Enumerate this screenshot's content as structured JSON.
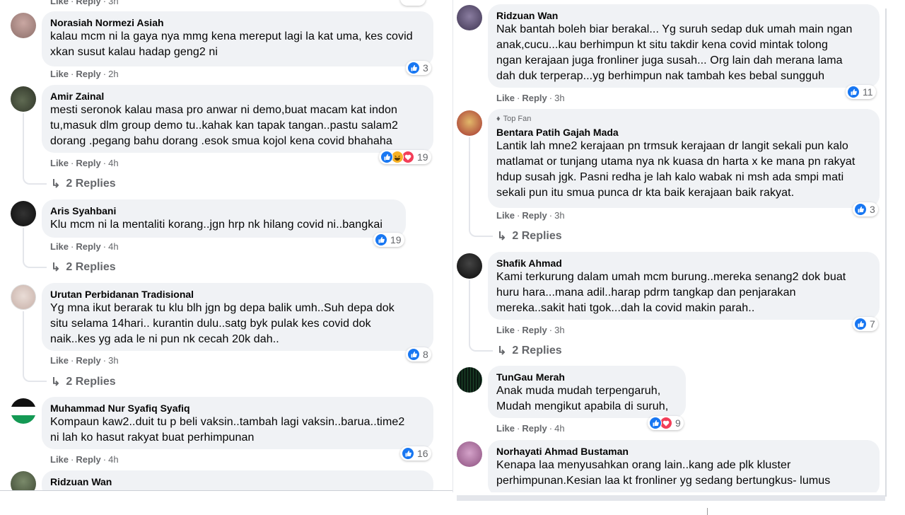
{
  "labels": {
    "like": "Like",
    "reply": "Reply",
    "top_fan": "Top Fan",
    "replies_2": "2 Replies"
  },
  "colors": {
    "like_blue": "#1877f2",
    "love_red": "#f33e58",
    "haha_yellow": "#f7b125",
    "meta_grey": "#65676b",
    "bubble": "#f0f2f5"
  },
  "left": {
    "top_meta": {
      "time": "3h"
    },
    "comments": [
      {
        "name": "Norasiah Normezi Asiah",
        "text": "kalau mcm ni la gaya nya mmg kena mereput lagi la kat uma, kes covid\nxkan susut kalau hadap geng2 ni",
        "time": "2h",
        "reactions": [
          "like-icon"
        ],
        "count": "3",
        "replies": ""
      },
      {
        "name": "Amir Zainal",
        "text": "mesti seronok kalau masa pro anwar ni demo,buat macam kat indon\ntu,masuk dlm group demo tu..kahak kan tapak tangan..pastu salam2\ndorang .pegang bahu dorang .esok smua kojol kena covid bhahaha",
        "time": "4h",
        "reactions": [
          "like-icon",
          "haha-icon",
          "love-icon"
        ],
        "count": "19",
        "replies": "2 Replies"
      },
      {
        "name": "Aris Syahbani",
        "text": "Klu mcm ni la mentaliti korang..jgn hrp nk hilang covid ni..bangkai",
        "time": "4h",
        "reactions": [
          "like-icon"
        ],
        "count": "19",
        "replies": "2 Replies"
      },
      {
        "name": "Urutan Perbidanan Tradisional",
        "text": "Yg mna ikut berarak tu klu blh jgn bg depa balik umh..Suh depa dok\nsitu selama 14hari.. kurantin dulu..satg byk pulak kes covid dok\nnaik..kes yg ada le ni pun nk cecah 20k dah..",
        "time": "3h",
        "reactions": [
          "like-icon"
        ],
        "count": "8",
        "replies": "2 Replies"
      },
      {
        "name": "Muhammad Nur Syafiq Syafiq",
        "text": "Kompaun kaw2..duit tu p beli vaksin..tambah lagi vaksin..barua..time2\nni lah ko hasut rakyat buat perhimpunan",
        "time": "4h",
        "reactions": [
          "like-icon"
        ],
        "count": "16",
        "replies": ""
      },
      {
        "name": "Ridzuan Wan",
        "text": "",
        "time": "",
        "reactions": [],
        "count": "",
        "replies": ""
      }
    ]
  },
  "right": {
    "comments": [
      {
        "name": "Ridzuan Wan",
        "top_fan": false,
        "text": "Nak bantah boleh biar berakal... Yg suruh sedap duk umah main ngan\nanak,cucu...kau berhimpun kt situ takdir kena covid mintak tolong\nngan kerajaan juga fronliner juga susah... Org lain dah merana lama\ndah duk terperap...yg berhimpun nak tambah kes bebal sungguh",
        "time": "3h",
        "reactions": [
          "like-icon"
        ],
        "count": "11",
        "replies": ""
      },
      {
        "name": "Bentara Patih Gajah Mada",
        "top_fan": true,
        "text": "Lantik lah mne2 kerajaan pn trmsuk kerajaan dr langit sekali pun kalo\nmatlamat or tunjang utama nya nk kuasa dn harta x ke mana pn rakyat\nhdup susah jgk. Pasni redha je lah kalo wabak ni msh ada smpi mati\nsekali pun itu smua punca dr kta baik kerajaan baik rakyat.",
        "time": "3h",
        "reactions": [
          "like-icon"
        ],
        "count": "3",
        "replies": "2 Replies"
      },
      {
        "name": "Shafik Ahmad",
        "top_fan": false,
        "text": "Kami terkurung dalam umah mcm burung..mereka senang2 dok buat\nhuru hara...mana adil..harap pdrm tangkap dan penjarakan\nmereka..sakit hati tgok...dah la covid makin parah..",
        "time": "3h",
        "reactions": [
          "like-icon"
        ],
        "count": "7",
        "replies": "2 Replies"
      },
      {
        "name": "TunGau Merah",
        "top_fan": false,
        "text": "Anak muda mudah terpengaruh,\nMudah mengikut apabila di suruh,",
        "time": "4h",
        "reactions": [
          "like-icon",
          "love-icon"
        ],
        "count": "9",
        "replies": ""
      },
      {
        "name": "Norhayati Ahmad Bustaman",
        "top_fan": false,
        "text": "Kenapa laa menyusahkan orang lain..kang ade plk kluster\nperhimpunan.Kesian laa kt fronliner yg sedang bertungkus- lumus",
        "time": "",
        "reactions": [],
        "count": "",
        "replies": ""
      }
    ]
  }
}
